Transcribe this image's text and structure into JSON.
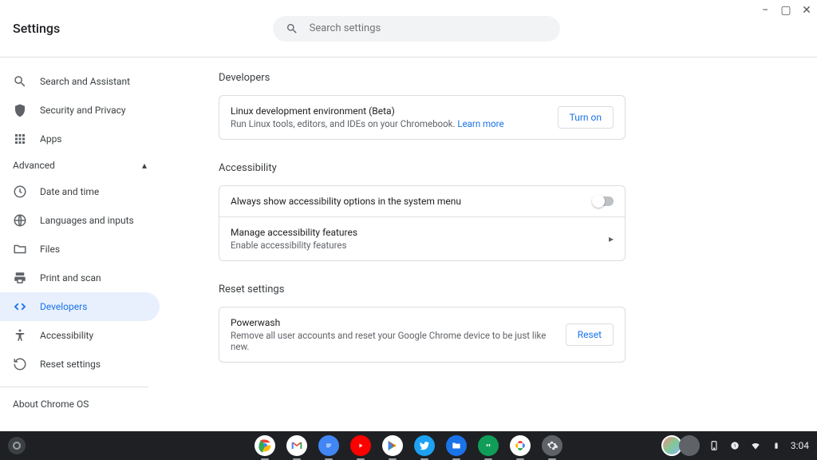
{
  "header": {
    "title": "Settings",
    "search_placeholder": "Search settings"
  },
  "sidebar": {
    "items": [
      {
        "label": "Search and Assistant"
      },
      {
        "label": "Security and Privacy"
      },
      {
        "label": "Apps"
      }
    ],
    "advanced_label": "Advanced",
    "advanced_items": [
      {
        "label": "Date and time"
      },
      {
        "label": "Languages and inputs"
      },
      {
        "label": "Files"
      },
      {
        "label": "Print and scan"
      },
      {
        "label": "Developers"
      },
      {
        "label": "Accessibility"
      },
      {
        "label": "Reset settings"
      }
    ],
    "about_label": "About Chrome OS"
  },
  "main": {
    "developers": {
      "title": "Developers",
      "linux": {
        "title": "Linux development environment (Beta)",
        "subtitle": "Run Linux tools, editors, and IDEs on your Chromebook. ",
        "learn_more": "Learn more",
        "button": "Turn on"
      }
    },
    "accessibility": {
      "title": "Accessibility",
      "always_show": {
        "title": "Always show accessibility options in the system menu",
        "enabled": false
      },
      "manage": {
        "title": "Manage accessibility features",
        "subtitle": "Enable accessibility features"
      }
    },
    "reset": {
      "title": "Reset settings",
      "powerwash": {
        "title": "Powerwash",
        "subtitle": "Remove all user accounts and reset your Google Chrome device to be just like new.",
        "button": "Reset"
      }
    }
  },
  "shelf": {
    "time": "3:04"
  }
}
